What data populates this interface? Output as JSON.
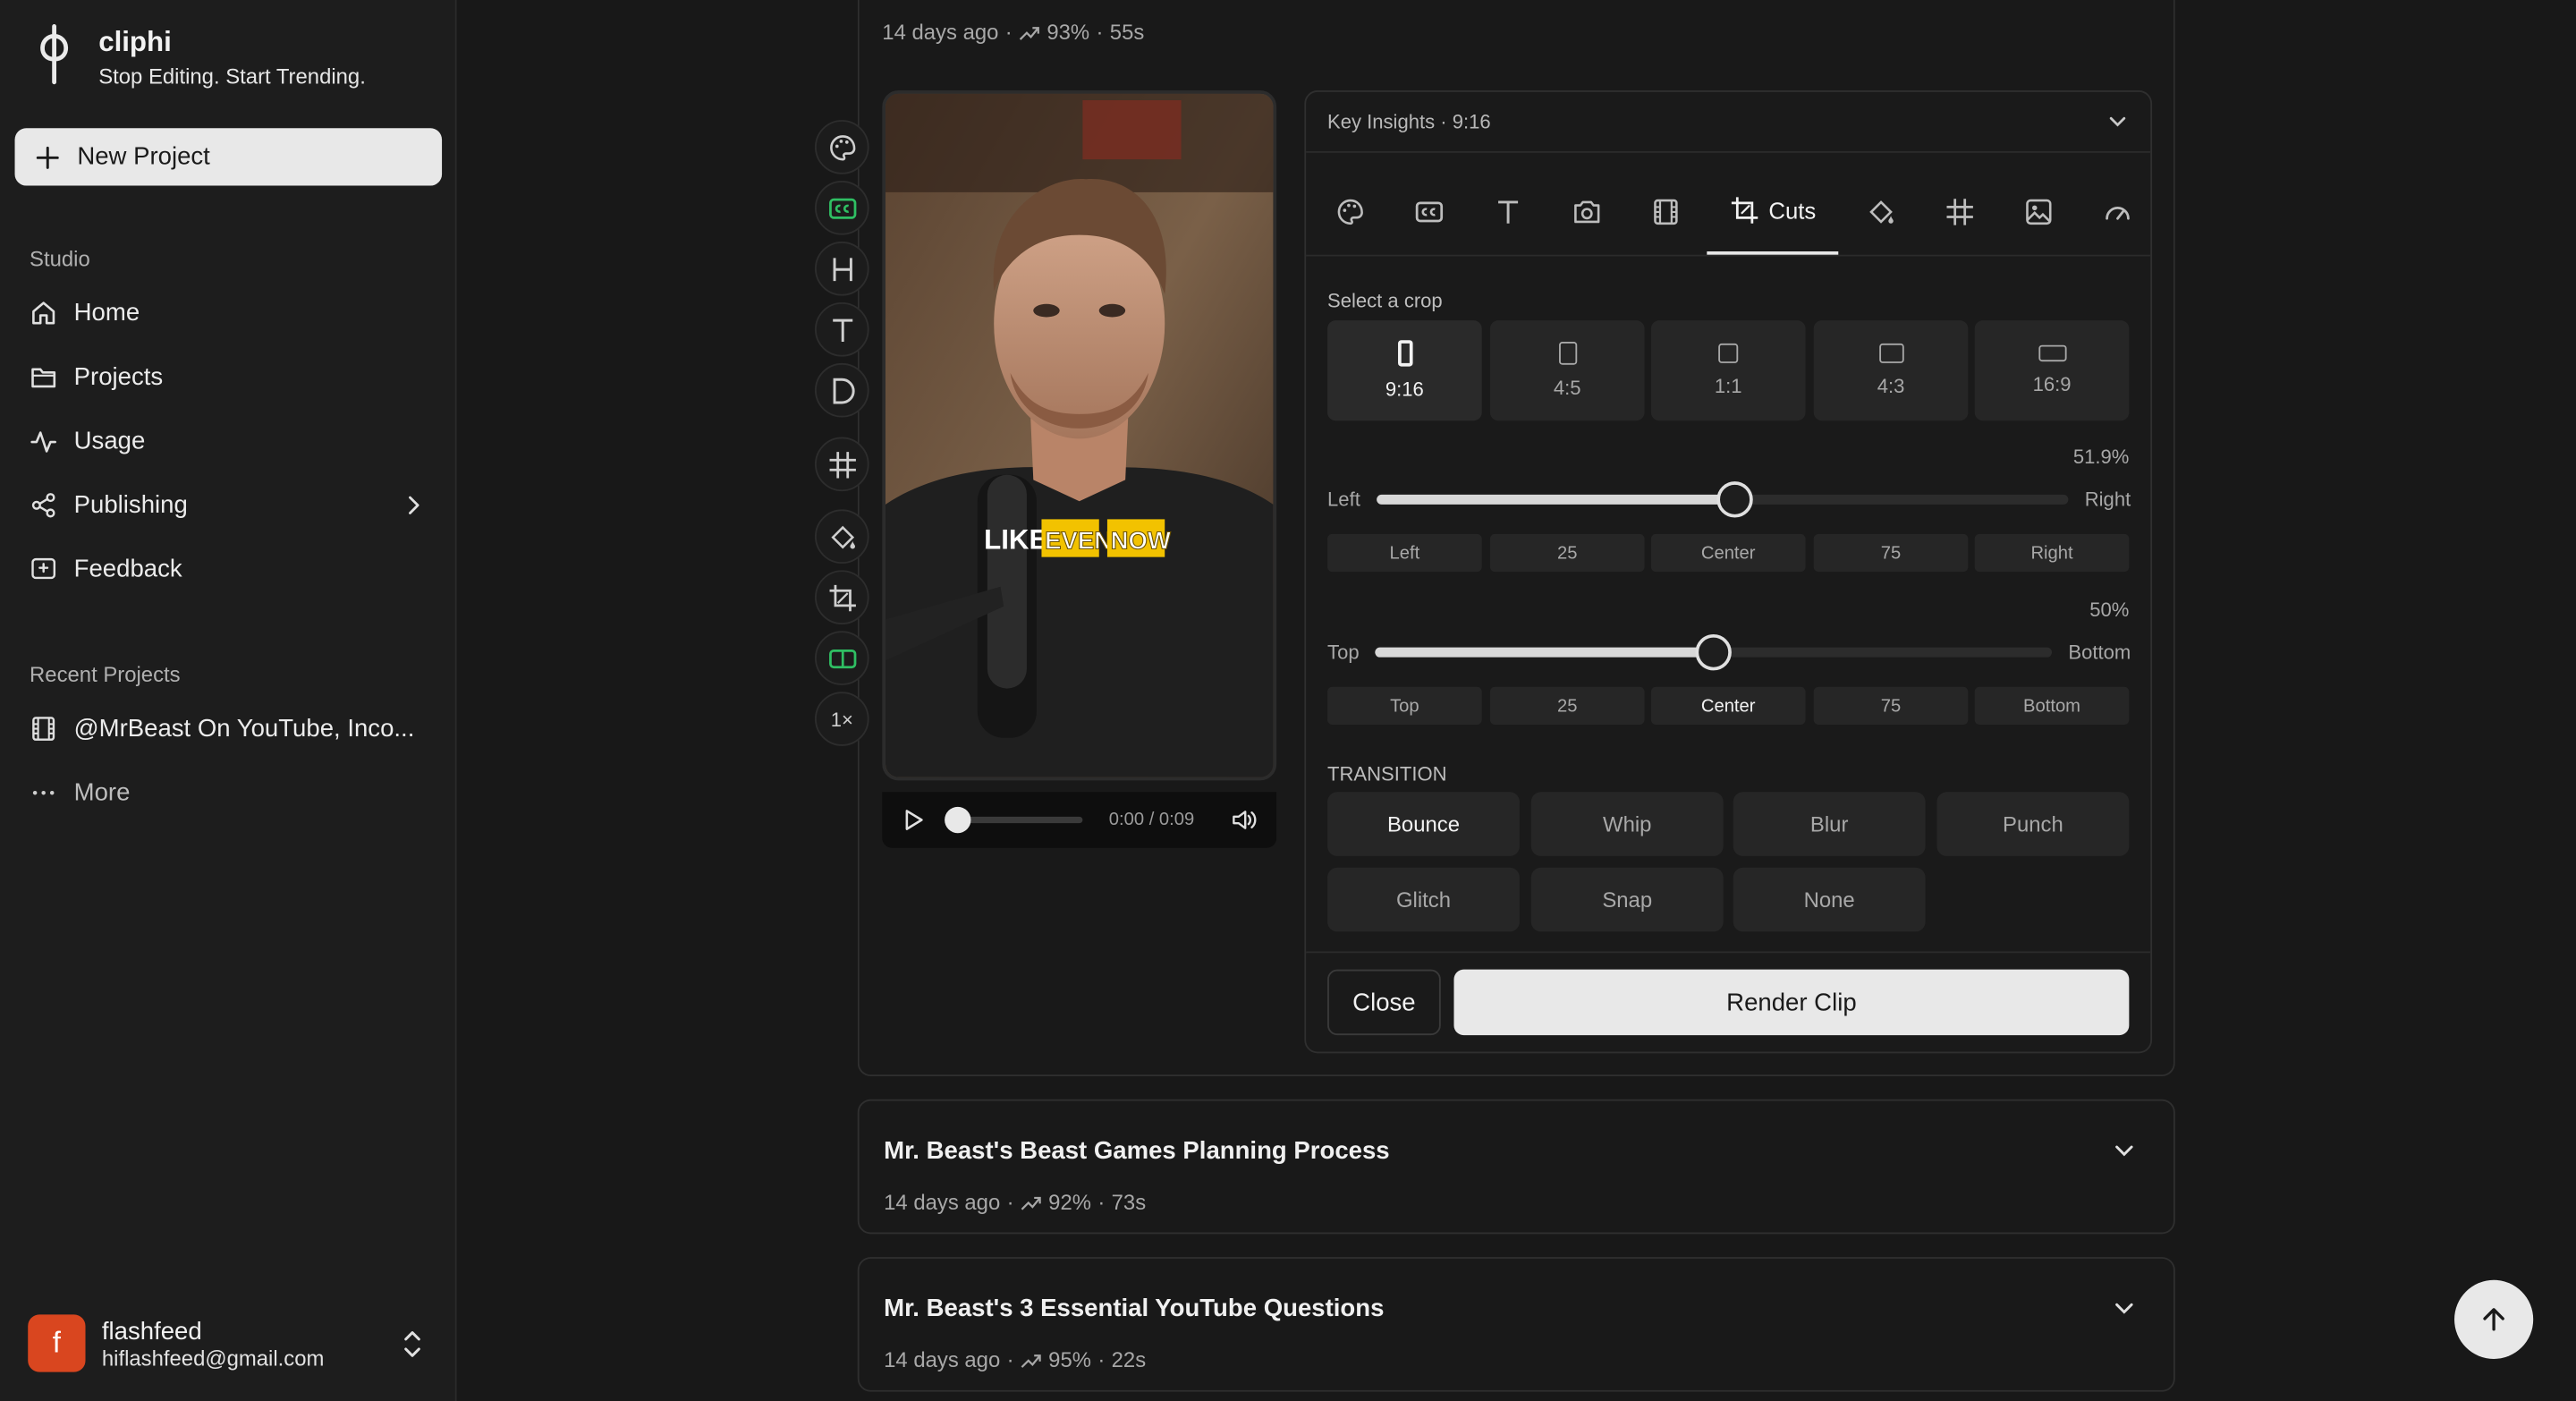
{
  "brand": {
    "name": "cliphi",
    "tagline": "Stop Editing. Start Trending."
  },
  "sidebar": {
    "new_project": "New Project",
    "studio_label": "Studio",
    "nav": [
      {
        "label": "Home",
        "icon": "home-icon"
      },
      {
        "label": "Projects",
        "icon": "folder-icon"
      },
      {
        "label": "Usage",
        "icon": "activity-icon"
      },
      {
        "label": "Publishing",
        "icon": "share-icon"
      },
      {
        "label": "Feedback",
        "icon": "feedback-icon"
      }
    ],
    "recent_label": "Recent Projects",
    "recent": [
      {
        "label": "@MrBeast On YouTube, Inco..."
      }
    ],
    "more": "More"
  },
  "user": {
    "initial": "f",
    "name": "flashfeed",
    "email": "hiflashfeed@gmail.com"
  },
  "current_clip": {
    "age": "14 days ago",
    "score": "93%",
    "duration": "55s"
  },
  "toolbar": {
    "buttons": [
      "palette-icon",
      "captions-icon",
      "heading-icon",
      "text-icon",
      "d-icon",
      "grid-icon",
      "paint-bucket-icon",
      "crop-icon",
      "layout-icon",
      "speed-icon"
    ],
    "speed": "1×"
  },
  "player": {
    "caption_words": [
      "LIKE",
      "EVEN",
      "NOW"
    ],
    "time": "0:00 / 0:09"
  },
  "editor": {
    "title": "Key Insights · 9:16",
    "active_tab": "Cuts",
    "select_crop": "Select a crop",
    "crops": [
      "9:16",
      "4:5",
      "1:1",
      "4:3",
      "16:9"
    ],
    "selected_crop": "9:16",
    "horizontal": {
      "percent": "51.9%",
      "min": "Left",
      "max": "Right",
      "value": 0.519,
      "presets": [
        "Left",
        "25",
        "Center",
        "75",
        "Right"
      ]
    },
    "vertical": {
      "percent": "50%",
      "min": "Top",
      "max": "Bottom",
      "value": 0.5,
      "presets": [
        "Top",
        "25",
        "Center",
        "75",
        "Bottom"
      ],
      "selected": "Center"
    },
    "transition_label": "TRANSITION",
    "transitions": [
      "Bounce",
      "Whip",
      "Blur",
      "Punch",
      "Glitch",
      "Snap",
      "None"
    ],
    "selected_transition": "Bounce",
    "close": "Close",
    "render": "Render Clip"
  },
  "clips": [
    {
      "title": "Mr. Beast's Beast Games Planning Process",
      "age": "14 days ago",
      "score": "92%",
      "duration": "73s"
    },
    {
      "title": "Mr. Beast's 3 Essential YouTube Questions",
      "age": "14 days ago",
      "score": "95%",
      "duration": "22s"
    }
  ],
  "colors": {
    "accent_green": "#2fbf63",
    "avatar": "#d9461f",
    "caption_highlight": "#f2c200"
  }
}
